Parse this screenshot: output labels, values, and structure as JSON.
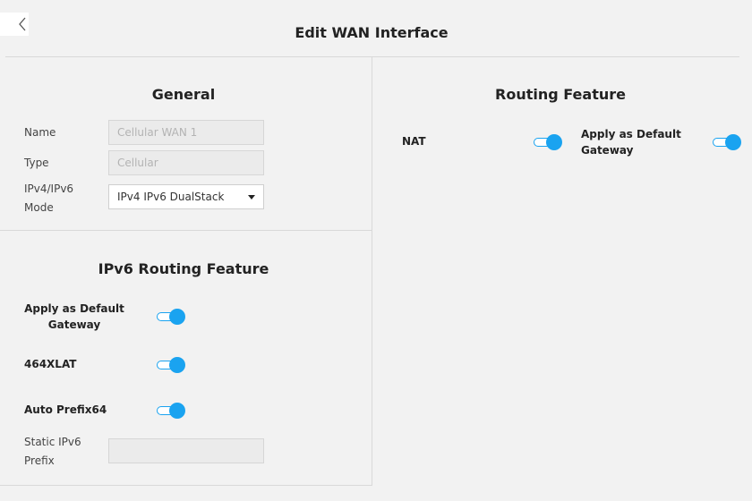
{
  "header": {
    "title": "Edit WAN Interface",
    "back_icon": "chevron-left-icon"
  },
  "general": {
    "title": "General",
    "name_label": "Name",
    "name_placeholder": "Cellular WAN 1",
    "type_label": "Type",
    "type_placeholder": "Cellular",
    "mode_label_line1": "IPv4/IPv6",
    "mode_label_line2": "Mode",
    "mode_value": "IPv4 IPv6 DualStack"
  },
  "routing": {
    "title": "Routing Feature",
    "nat_label": "NAT",
    "nat_on": true,
    "gateway_label_line1": "Apply as Default",
    "gateway_label_line2": "Gateway",
    "gateway_on": true
  },
  "ipv6_routing": {
    "title": "IPv6 Routing Feature",
    "gateway_label_line1": "Apply as Default",
    "gateway_label_line2": "Gateway",
    "gateway_on": true,
    "xlat_label": "464XLAT",
    "xlat_on": true,
    "prefix64_label": "Auto Prefix64",
    "prefix64_on": true,
    "static_prefix_label_line1": "Static IPv6",
    "static_prefix_label_line2": "Prefix",
    "static_prefix_value": ""
  },
  "colors": {
    "accent": "#1aa3f0",
    "background": "#f2f2f2"
  }
}
